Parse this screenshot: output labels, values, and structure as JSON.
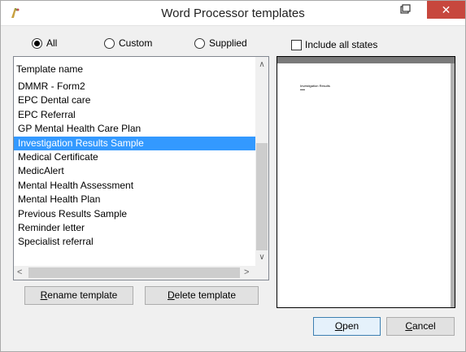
{
  "window": {
    "title": "Word Processor templates"
  },
  "filters": {
    "all_label": "All",
    "custom_label": "Custom",
    "supplied_label": "Supplied",
    "selected": "All",
    "include_all_states_label": "Include all states",
    "include_all_states_checked": false
  },
  "templates": {
    "header": "Template name",
    "items": [
      "DMMR - Form2",
      "EPC Dental care",
      "EPC Referral",
      "GP Mental Health Care Plan",
      "Investigation Results Sample",
      "Medical Certificate",
      "MedicAlert",
      "Mental Health Assessment",
      "Mental Health Plan",
      "Previous Results Sample",
      "Reminder letter",
      "Specialist referral"
    ],
    "selected_index": 4
  },
  "buttons": {
    "rename_accel": "R",
    "rename_rest": "ename template",
    "delete_accel": "D",
    "delete_rest": "elete template",
    "open_accel": "O",
    "open_rest": "pen",
    "cancel_accel": "C",
    "cancel_rest": "ancel"
  },
  "preview": {
    "heading": "Investigation Results"
  },
  "colors": {
    "selection": "#3399ff",
    "close_button": "#c7473d"
  }
}
